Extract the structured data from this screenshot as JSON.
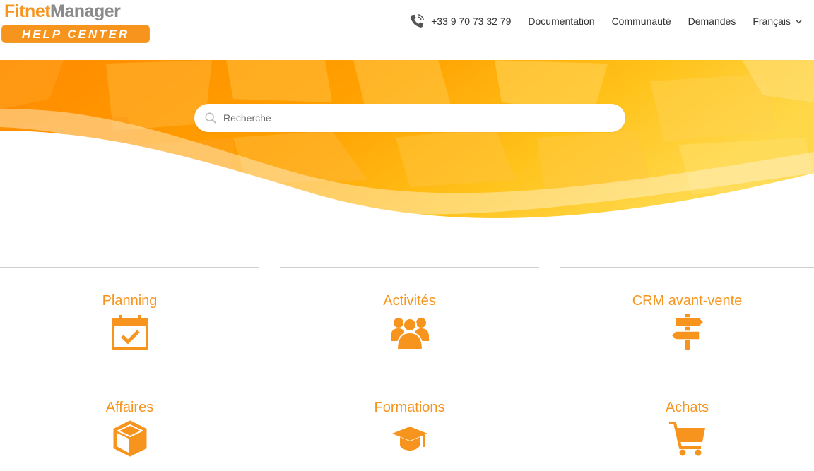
{
  "logo": {
    "part1": "Fitnet",
    "part2": "Manager",
    "badge": "HELP CENTER"
  },
  "nav": {
    "phone": "+33 9 70 73 32 79",
    "documentation": "Documentation",
    "community": "Communauté",
    "requests": "Demandes",
    "language": "Français"
  },
  "search": {
    "placeholder": "Recherche"
  },
  "categories": [
    {
      "title": "Planning",
      "icon": "calendar-check-icon"
    },
    {
      "title": "Activités",
      "icon": "users-group-icon"
    },
    {
      "title": "CRM avant-vente",
      "icon": "signpost-icon"
    },
    {
      "title": "Affaires",
      "icon": "box-icon"
    },
    {
      "title": "Formations",
      "icon": "graduation-cap-icon"
    },
    {
      "title": "Achats",
      "icon": "shopping-cart-icon"
    }
  ],
  "colors": {
    "accent": "#f7941d",
    "divider": "#cfcfcf",
    "text": "#333333"
  }
}
